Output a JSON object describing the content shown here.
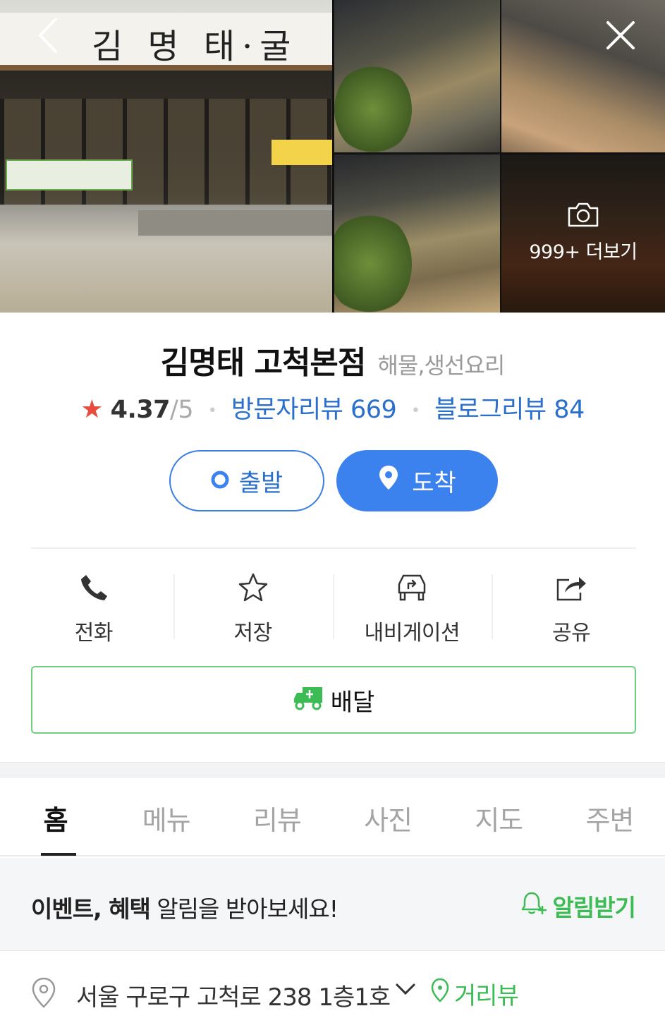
{
  "photos": {
    "main_sign": "김 명 태·굴",
    "more_label": "999+ 더보기"
  },
  "place": {
    "name": "김명태 고척본점",
    "category": "해물,생선요리"
  },
  "rating": {
    "score": "4.37",
    "out_of": "/5",
    "visitor_reviews": "방문자리뷰 669",
    "blog_reviews": "블로그리뷰 84"
  },
  "route": {
    "depart_label": "출발",
    "arrive_label": "도착"
  },
  "actions": [
    {
      "label": "전화",
      "icon": "phone-icon"
    },
    {
      "label": "저장",
      "icon": "star-outline-icon"
    },
    {
      "label": "내비게이션",
      "icon": "car-navigation-icon"
    },
    {
      "label": "공유",
      "icon": "share-icon"
    }
  ],
  "delivery": {
    "label": "배달",
    "color": "#3dbb55"
  },
  "tabs": [
    {
      "label": "홈",
      "active": true
    },
    {
      "label": "메뉴",
      "active": false
    },
    {
      "label": "리뷰",
      "active": false
    },
    {
      "label": "사진",
      "active": false
    },
    {
      "label": "지도",
      "active": false
    },
    {
      "label": "주변",
      "active": false
    }
  ],
  "notice": {
    "bold_part": "이벤트, 혜택",
    "rest": " 알림을 받아보세요!",
    "button": "알림받기"
  },
  "address": {
    "text": "서울 구로구 고척로 238 1층1호",
    "streetview": "거리뷰"
  },
  "colors": {
    "accent_blue": "#3b82ee",
    "link_blue": "#2a6fcb",
    "green": "#3dbb55",
    "star_red": "#e74c3c"
  }
}
